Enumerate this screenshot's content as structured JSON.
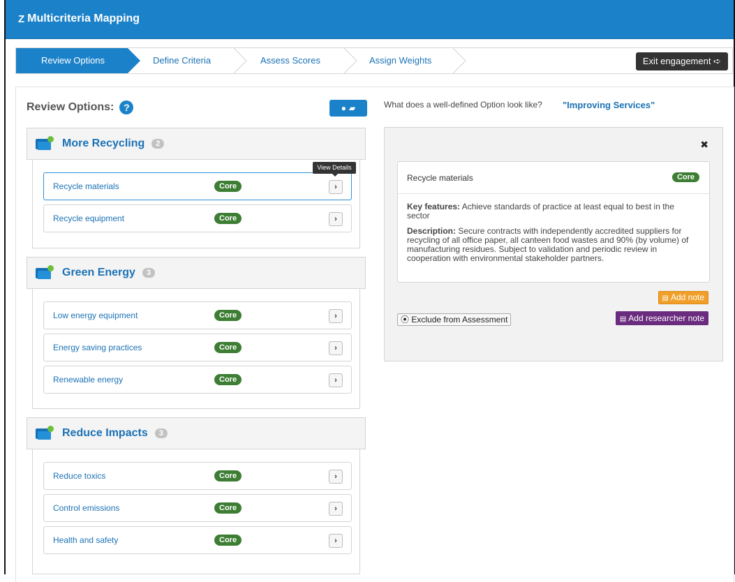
{
  "app": {
    "title": "Multicriteria Mapping",
    "logo_glyph": "Z"
  },
  "wizard": {
    "steps": [
      {
        "label": "Review Options",
        "active": true
      },
      {
        "label": "Define Criteria",
        "active": false
      },
      {
        "label": "Assess Scores",
        "active": false
      },
      {
        "label": "Assign Weights",
        "active": false
      }
    ],
    "exit_label": "Exit engagement",
    "exit_icon": "sign-out-icon"
  },
  "review": {
    "title": "Review Options:",
    "help_icon": "question-circle-icon",
    "add_button_icon": "add-folder-icon"
  },
  "groups": [
    {
      "title": "More Recycling",
      "count": "2",
      "options": [
        {
          "label": "Recycle materials",
          "badge": "Core",
          "selected": true
        },
        {
          "label": "Recycle equipment",
          "badge": "Core",
          "selected": false
        }
      ]
    },
    {
      "title": "Green Energy",
      "count": "3",
      "options": [
        {
          "label": "Low energy equipment",
          "badge": "Core"
        },
        {
          "label": "Energy saving practices",
          "badge": "Core"
        },
        {
          "label": "Renewable energy",
          "badge": "Core"
        }
      ]
    },
    {
      "title": "Reduce Impacts",
      "count": "3",
      "options": [
        {
          "label": "Reduce toxics",
          "badge": "Core"
        },
        {
          "label": "Control emissions",
          "badge": "Core"
        },
        {
          "label": "Health and safety",
          "badge": "Core"
        }
      ]
    }
  ],
  "tooltip": "View Details",
  "guidance": {
    "question": "What does a well-defined Option look like?",
    "example_link": "\"Improving Services\""
  },
  "detail": {
    "close_glyph": "✖",
    "title": "Recycle materials",
    "badge": "Core",
    "key_features_label": "Key features:",
    "key_features": "Achieve standards of practice at least equal to best in the sector",
    "description_label": "Description:",
    "description": "Secure contracts with independently accredited suppliers for recycling of all office paper, all canteen food wastes and 90% (by volume) of manufacturing residues. Subject to validation and periodic review in cooperation with environmental stakeholder partners.",
    "add_note": "Add note",
    "exclude": "Exclude from Assessment",
    "add_researcher_note": "Add researcher note"
  },
  "colors": {
    "primary": "#1b82c9",
    "core_badge": "#3d7d34",
    "add_note": "#f0a02a",
    "researcher_note": "#6b2c80"
  }
}
